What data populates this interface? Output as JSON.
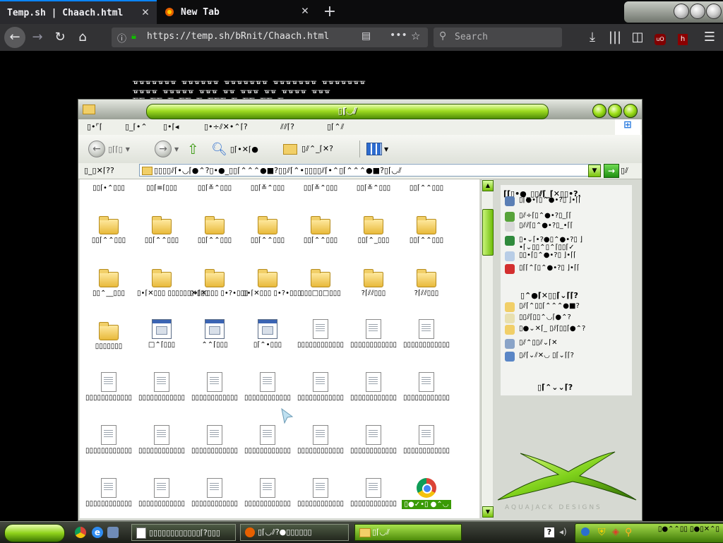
{
  "browser": {
    "tabs": [
      {
        "title": "Temp.sh | Chaach.html",
        "active": true
      },
      {
        "title": "New Tab",
        "active": false
      }
    ],
    "url": "https://temp.sh/bRnit/Chaach.html",
    "search_placeholder": "Search"
  },
  "page": {
    "glyph_rows": [
      "ᚗᚗᚗᚗᚗᚗᚗ ᚗᚗᚗᚗᚗᚗ ᚗᚗᚗᚗᚗᚗᚗ ᚗᚗᚗᚗᚗᚗᚗ ᚗᚗᚗᚗᚗᚗᚗ",
      "ᚗᚗᚗᚗ ᚗᚗᚗᚗᚗ ᚗᚗᚗ ᚗᚗ ᚗᚗᚗ ᚗᚗ ᚗᚗᚗᚗ ᚗᚗᚗ",
      "ᚗᚗ ᚗᚗ ᚗ ᚗᚗ ᚗ ᚗᚗᚗ ᚗ ᚗᚗ ᚗᚗ ᚗ"
    ]
  },
  "explorer": {
    "title": "▯⌈◡⫽",
    "menu": [
      "▯•⌜⌈",
      "▯_⌈•⌃",
      "▯•⌈◂",
      "▯•÷⫽✕•⌃⌈?",
      "⫽⫽⌈?",
      "▯⌈⌃⫽"
    ],
    "toolbar": {
      "back": "▯⌈⌈▯",
      "search": "▯⌈•✕⌈●",
      "folders": "▯⫽⌃_⌈✕?",
      "views_icon": "views-icon"
    },
    "address": {
      "label": "▯_▯✕⌈??",
      "value": "▯▯▯▯⫽⌈•◡⌈●⌃?▯•●_▯▯⌈⌃⌃⌃●■?▯▯⫽⌈⌃•▯▯▯▯⫽⌈•⌃▯⌈⌃⌃⌃●■?▯⌈◡⫽",
      "go_label": "▯⫽"
    },
    "files": [
      {
        "type": "label",
        "name": "▯▯⌈•⌃▯▯▯"
      },
      {
        "type": "label",
        "name": "▯▯⌈≡⌈▯▯▯"
      },
      {
        "type": "label",
        "name": "▯▯⌈≚⌃▯▯▯"
      },
      {
        "type": "label",
        "name": "▯▯⌈≚⌃▯▯▯"
      },
      {
        "type": "label",
        "name": "▯▯⌈≚⌃▯▯▯"
      },
      {
        "type": "label",
        "name": "▯▯⌈≚⌃▯▯▯"
      },
      {
        "type": "label",
        "name": "▯▯⌈⌃⌃▯▯▯"
      },
      {
        "type": "folder",
        "name": "▯▯⌈⌃⌃▯▯▯"
      },
      {
        "type": "folder",
        "name": "▯▯⌈⌃⌃▯▯▯"
      },
      {
        "type": "folder",
        "name": "▯▯⌈⌃⌃▯▯▯"
      },
      {
        "type": "folder",
        "name": "▯▯⌈⌃⌃▯▯▯"
      },
      {
        "type": "folder",
        "name": "▯▯⌈⌃⌃▯▯▯"
      },
      {
        "type": "folder",
        "name": "▯▯⌈⌃_▯▯▯"
      },
      {
        "type": "folder",
        "name": "▯▯⌈⌃⌃▯▯▯"
      },
      {
        "type": "folder",
        "name": "▯▯⌃__▯▯▯"
      },
      {
        "type": "folder",
        "name": "▯•⌈✕▯▯▯ ▯▯▯▯▯▯✕▯▯▯"
      },
      {
        "type": "folder",
        "name": "▯•⌈✕▯▯▯ ▯•?•▯▯▯"
      },
      {
        "type": "folder",
        "name": "▯•⌈✕▯▯▯ ▯•?•▯▯▯"
      },
      {
        "type": "folder",
        "name": "▯▯▯□▯□▯▯▯"
      },
      {
        "type": "folder",
        "name": "?⌈⫽⫽▯▯▯"
      },
      {
        "type": "folder",
        "name": "?⌈⫽⫽▯▯▯"
      },
      {
        "type": "folder",
        "name": "▯▯▯▯▯▯▯"
      },
      {
        "type": "exe",
        "name": "□⌃⌈▯▯▯"
      },
      {
        "type": "exe",
        "name": "⌃⌃⌈▯▯▯"
      },
      {
        "type": "shortcut",
        "name": "▯⌈⌃•▯▯▯"
      },
      {
        "type": "doc",
        "name": "▯▯▯▯▯▯▯▯▯▯▯▯"
      },
      {
        "type": "doc",
        "name": "▯▯▯▯▯▯▯▯▯▯▯▯"
      },
      {
        "type": "doc",
        "name": "▯▯▯▯▯▯▯▯▯▯▯▯"
      },
      {
        "type": "doc",
        "name": "▯▯▯▯▯▯▯▯▯▯▯▯"
      },
      {
        "type": "doc",
        "name": "▯▯▯▯▯▯▯▯▯▯▯▯"
      },
      {
        "type": "doc",
        "name": "▯▯▯▯▯▯▯▯▯▯▯▯"
      },
      {
        "type": "doc",
        "name": "▯▯▯▯▯▯▯▯▯▯▯▯"
      },
      {
        "type": "doc",
        "name": "▯▯▯▯▯▯▯▯▯▯▯▯"
      },
      {
        "type": "doc",
        "name": "▯▯▯▯▯▯▯▯▯▯▯▯"
      },
      {
        "type": "doc",
        "name": "▯▯▯▯▯▯▯▯▯▯▯▯"
      },
      {
        "type": "doc",
        "name": "▯▯▯▯▯▯▯▯▯▯▯▯"
      },
      {
        "type": "doc",
        "name": "▯▯▯▯▯▯▯▯▯▯▯▯"
      },
      {
        "type": "doc",
        "name": "▯▯▯▯▯▯▯▯▯▯▯▯"
      },
      {
        "type": "doc",
        "name": "▯▯▯▯▯▯▯▯▯▯▯▯"
      },
      {
        "type": "doc",
        "name": "▯▯▯▯▯▯▯▯▯▯▯▯"
      },
      {
        "type": "doc",
        "name": "▯▯▯▯▯▯▯▯▯▯▯▯"
      },
      {
        "type": "doc",
        "name": "▯▯▯▯▯▯▯▯▯▯▯▯"
      },
      {
        "type": "doc",
        "name": "▯▯▯▯▯▯▯▯▯▯▯▯"
      },
      {
        "type": "doc",
        "name": "▯▯▯▯▯▯▯▯▯▯▯▯"
      },
      {
        "type": "doc",
        "name": "▯▯▯▯▯▯▯▯▯▯▯▯"
      },
      {
        "type": "doc",
        "name": "▯▯▯▯▯▯▯▯▯▯▯▯"
      },
      {
        "type": "doc",
        "name": "▯▯▯▯▯▯▯▯▯▯▯▯"
      },
      {
        "type": "doc",
        "name": "▯▯▯▯▯▯▯▯▯▯▯▯"
      },
      {
        "type": "chrome",
        "name": "▯●✓•▯ ●⌃◡",
        "selected": true
      }
    ],
    "sidepane": {
      "tasks_title": "⌈⌈▯•●_▯▯⫽⌈_⌈✕▯▯•?.",
      "tasks": [
        {
          "icon": "monitor-icon",
          "label": "▯⌈●•⌈▯⌃●•?▯ ⌋•⌈⌈"
        },
        {
          "icon": "move-icon",
          "label": "▯⫽÷⌈▯⌃●•?▯_⌈⌈"
        },
        {
          "icon": "copy-icon",
          "label": "▯⫽⫽⌈▯⌃●•?▯_•⌈⌈"
        },
        {
          "icon": "globe-icon",
          "label": "▯•⌄⌈•?●▯⌃●•?▯ ⌋•⌈⌄▯▯⌃▯⌃⌈▯▯⌈✓"
        },
        {
          "icon": "email-icon",
          "label": "▯▯•⌈▯⌃●•?▯ ⌋•⌈⌈"
        },
        {
          "icon": "delete-icon",
          "label": "▯⌈⌈⌃⌈▯⌃●•?▯ ⌋•⌈⌈"
        }
      ],
      "places_title": "▯⌃●⌈✕▯▯⌈⌄⌈⌈?",
      "places": [
        {
          "icon": "folder-icon",
          "label": "▯⫽⌈⌃▯▯⌈⌃⌃⌃●■?"
        },
        {
          "icon": "documents-icon",
          "label": "▯▯⫽⌈▯▯⌃◡⌈●⌃?"
        },
        {
          "icon": "folder-icon",
          "label": "▯●⌄✕⌈_ ▯⫽⌈▯▯⌈●⌃?"
        },
        {
          "icon": "computer-icon",
          "label": "▯⫽⌃▯▯⫽⌄⌈✕"
        },
        {
          "icon": "network-icon",
          "label": "▯⫽⌈⌄⫽✕◡ ▯⌈⌄⌈⌈?"
        }
      ],
      "details_title": "▯⌈⌃⌄⌄⌈?"
    },
    "brand": "AQUAJACK DESIGNS"
  },
  "taskbar": {
    "items": [
      {
        "icon": "notepad-icon",
        "label": "▯▯▯▯▯▯▯▯▯▯▯▯⌈?▯▯▯"
      },
      {
        "icon": "firefox-icon",
        "label": "▯⌈◡⫽?●▯▯▯▯▯▯"
      },
      {
        "icon": "folder-icon",
        "label": "▯⌈◡⫽"
      }
    ],
    "clock": "▯●⌃⌃▯▯ ▯●▯✕⌃▯"
  },
  "colors": {
    "accent_green": "#7fd11b",
    "firefox_dark": "#323234",
    "selection": "#3a9a06"
  }
}
